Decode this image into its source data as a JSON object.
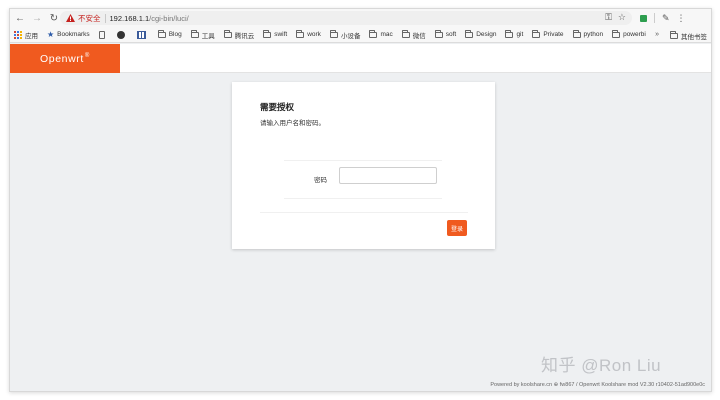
{
  "browser": {
    "insecure_label": "不安全",
    "url_host": "192.168.1.1",
    "url_path": "/cgi-bin/luci/",
    "icons": {
      "back": "back-arrow-icon",
      "forward": "forward-arrow-icon",
      "reload": "reload-icon",
      "warning": "warning-icon",
      "key": "key-icon",
      "bookmark_star": "star-icon"
    }
  },
  "bookmarks": {
    "items": [
      {
        "label": "应用",
        "icon": "apps-icon"
      },
      {
        "label": "Bookmarks",
        "icon": "star-icon"
      },
      {
        "label": "",
        "icon": "document-icon"
      },
      {
        "label": "",
        "icon": "circle-icon"
      },
      {
        "label": "",
        "icon": "columns-icon"
      },
      {
        "label": "Blog",
        "icon": "folder-icon"
      },
      {
        "label": "工具",
        "icon": "folder-icon"
      },
      {
        "label": "腾讯云",
        "icon": "folder-icon"
      },
      {
        "label": "swift",
        "icon": "folder-icon"
      },
      {
        "label": "work",
        "icon": "folder-icon"
      },
      {
        "label": "小设备",
        "icon": "folder-icon"
      },
      {
        "label": "mac",
        "icon": "folder-icon"
      },
      {
        "label": "微信",
        "icon": "folder-icon"
      },
      {
        "label": "soft",
        "icon": "folder-icon"
      },
      {
        "label": "Design",
        "icon": "folder-icon"
      },
      {
        "label": "git",
        "icon": "folder-icon"
      },
      {
        "label": "Private",
        "icon": "folder-icon"
      },
      {
        "label": "python",
        "icon": "folder-icon"
      },
      {
        "label": "powerbi",
        "icon": "folder-icon"
      }
    ],
    "more": "»",
    "other": "其他书签"
  },
  "header": {
    "brand": "Openwrt",
    "brand_mark": "®"
  },
  "login": {
    "title": "需要授权",
    "description": "请输入用户名和密码。",
    "password_label": "密码",
    "password_value": "",
    "submit_label": "登录"
  },
  "watermark": "知乎 @Ron Liu",
  "footer": "Powered by koolshare.cn ⊕ fw867 / Openwrt Koolshare mod V2.30 r10402-51ad900e0c",
  "colors": {
    "brand": "#f05a1f",
    "page_bg": "#eef0f2",
    "warning": "#c5221f"
  }
}
